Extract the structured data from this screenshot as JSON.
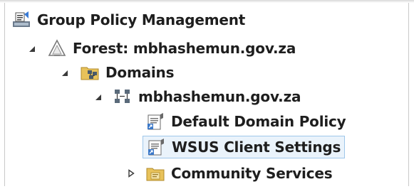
{
  "tree": {
    "root": {
      "label": "Group Policy Management",
      "icon": "gpm-console-icon"
    },
    "forest": {
      "label": "Forest: mbhashemun.gov.za",
      "icon": "forest-icon",
      "expanded": true
    },
    "domains": {
      "label": "Domains",
      "icon": "domains-folder-icon",
      "expanded": true
    },
    "domain": {
      "label": "mbhashemun.gov.za",
      "icon": "domain-icon",
      "expanded": true
    },
    "items": [
      {
        "label": "Default Domain Policy",
        "icon": "gpo-link-icon",
        "selected": false
      },
      {
        "label": "WSUS Client Settings",
        "icon": "gpo-link-icon",
        "selected": true
      },
      {
        "label": "Community Services",
        "icon": "ou-folder-icon",
        "expanded": false
      }
    ]
  },
  "colors": {
    "selection_border": "#9ec6ea",
    "selection_fill": "#eaf3fb",
    "text": "#1e1e1e",
    "folder": "#e8c25a"
  }
}
